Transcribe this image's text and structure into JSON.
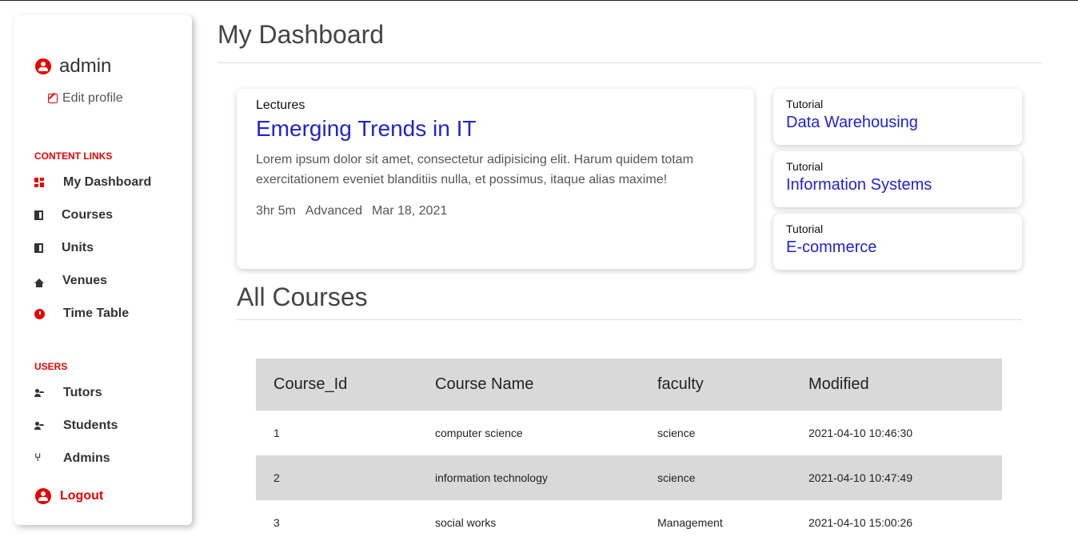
{
  "sidebar": {
    "username": "admin",
    "edit_profile": "Edit profile",
    "content_links_title": "CONTENT LINKS",
    "content_links": [
      {
        "label": "My Dashboard",
        "icon": "dashboard-icon"
      },
      {
        "label": "Courses",
        "icon": "book-icon"
      },
      {
        "label": "Units",
        "icon": "book-icon"
      },
      {
        "label": "Venues",
        "icon": "home-icon"
      },
      {
        "label": "Time Table",
        "icon": "clock-icon"
      }
    ],
    "users_title": "USERS",
    "users": [
      {
        "label": "Tutors",
        "icon": "users-icon"
      },
      {
        "label": "Students",
        "icon": "users-icon"
      },
      {
        "label": "Admins",
        "icon": "branch-icon"
      }
    ],
    "logout": "Logout"
  },
  "main": {
    "title": "My Dashboard",
    "lecture": {
      "kind": "Lectures",
      "title": "Emerging Trends in IT",
      "description": "Lorem ipsum dolor sit amet, consectetur adipisicing elit. Harum quidem totam exercitationem eveniet blanditiis nulla, et possimus, itaque alias maxime!",
      "duration": "3hr 5m",
      "level": "Advanced",
      "date": "Mar 18, 2021"
    },
    "tutorials": [
      {
        "kind": "Tutorial",
        "title": "Data Warehousing"
      },
      {
        "kind": "Tutorial",
        "title": "Information Systems"
      },
      {
        "kind": "Tutorial",
        "title": "E-commerce"
      }
    ],
    "courses_heading": "All Courses",
    "table": {
      "headers": [
        "Course_Id",
        "Course Name",
        "faculty",
        "Modified"
      ],
      "rows": [
        [
          "1",
          "computer science",
          "science",
          "2021-04-10 10:46:30"
        ],
        [
          "2",
          "information technology",
          "science",
          "2021-04-10 10:47:49"
        ],
        [
          "3",
          "social works",
          "Management",
          "2021-04-10 15:00:26"
        ]
      ]
    }
  },
  "colors": {
    "accent": "#e60000",
    "link": "#2222d0",
    "table_alt": "#d9d9d9"
  }
}
